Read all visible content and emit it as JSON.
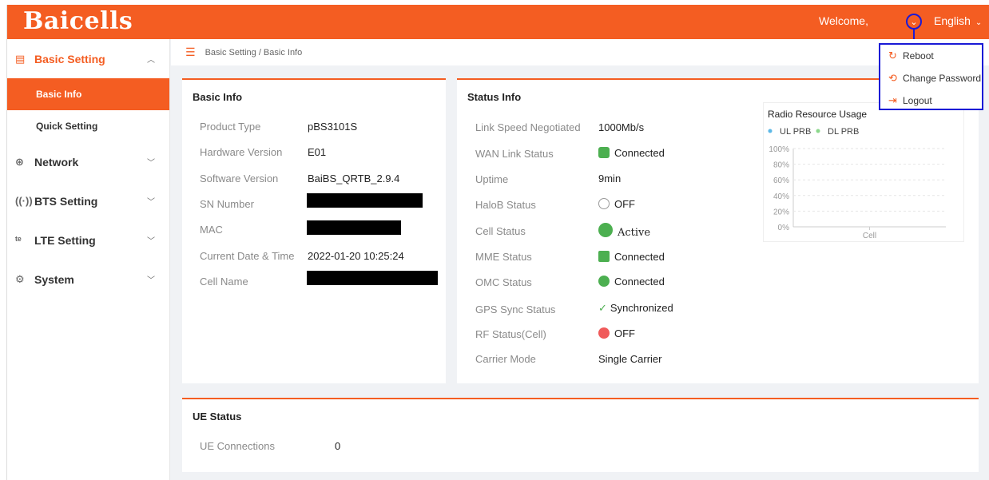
{
  "header": {
    "logo": "Baicells",
    "welcome": "Welcome,",
    "language": "English",
    "user_menu": [
      "Reboot",
      "Change Password",
      "Logout"
    ]
  },
  "sidebar": {
    "groups": [
      {
        "label": "Basic Setting",
        "expanded": true,
        "children": [
          "Basic Info",
          "Quick Setting"
        ]
      },
      {
        "label": "Network"
      },
      {
        "label": "BTS Setting"
      },
      {
        "label": "LTE Setting"
      },
      {
        "label": "System"
      }
    ],
    "active_child": "Basic Info"
  },
  "breadcrumb": "Basic Setting / Basic Info",
  "basic_info": {
    "title": "Basic Info",
    "rows": [
      {
        "label": "Product Type",
        "value": "pBS3101S"
      },
      {
        "label": "Hardware Version",
        "value": "E01"
      },
      {
        "label": "Software Version",
        "value": "BaiBS_QRTB_2.9.4"
      },
      {
        "label": "SN Number",
        "value": ""
      },
      {
        "label": "MAC",
        "value": ""
      },
      {
        "label": "Current Date & Time",
        "value": "2022-01-20 10:25:24"
      },
      {
        "label": "Cell Name",
        "value": ""
      }
    ]
  },
  "status_info": {
    "title": "Status Info",
    "rows": [
      {
        "label": "Link Speed Negotiated",
        "value": "1000Mb/s"
      },
      {
        "label": "WAN Link Status",
        "value": "Connected"
      },
      {
        "label": "Uptime",
        "value": "9min"
      },
      {
        "label": "HaloB Status",
        "value": "OFF"
      },
      {
        "label": "Cell Status",
        "value": "Active"
      },
      {
        "label": "MME Status",
        "value": "Connected"
      },
      {
        "label": "OMC Status",
        "value": "Connected"
      },
      {
        "label": "GPS Sync Status",
        "value": "Synchronized"
      },
      {
        "label": "RF Status(Cell)",
        "value": "OFF"
      },
      {
        "label": "Carrier Mode",
        "value": "Single Carrier"
      }
    ]
  },
  "chart_data": {
    "type": "bar",
    "title": "Radio Resource Usage",
    "categories": [
      "Cell"
    ],
    "series": [
      {
        "name": "UL PRB",
        "values": [
          0
        ]
      },
      {
        "name": "DL PRB",
        "values": [
          0
        ]
      }
    ],
    "yticks": [
      "100%",
      "80%",
      "60%",
      "40%",
      "20%",
      "0%"
    ],
    "ylim": [
      0,
      100
    ],
    "legend": "top-left",
    "colors": {
      "UL PRB": "#5cb8e6",
      "DL PRB": "#8bd88b"
    }
  },
  "ue_status": {
    "title": "UE Status",
    "label": "UE Connections",
    "value": "0"
  },
  "colors": {
    "accent": "#f45d22",
    "highlight": "#1a1ad6"
  }
}
